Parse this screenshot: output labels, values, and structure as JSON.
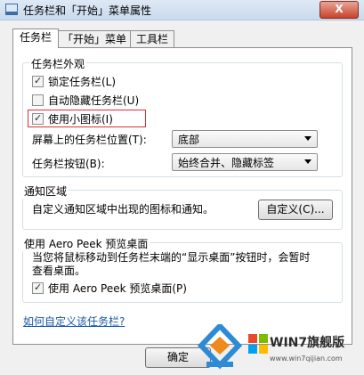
{
  "window": {
    "title": "任务栏和「开始」菜单属性",
    "close_label": "X"
  },
  "tabs": [
    {
      "label": "任务栏"
    },
    {
      "label": "「开始」菜单"
    },
    {
      "label": "工具栏"
    }
  ],
  "appearance": {
    "title": "任务栏外观",
    "lock_taskbar": {
      "label": "锁定任务栏(L)",
      "checked": true
    },
    "auto_hide": {
      "label": "自动隐藏任务栏(U)",
      "checked": false
    },
    "small_icons": {
      "label": "使用小图标(I)",
      "checked": true
    },
    "location": {
      "label": "屏幕上的任务栏位置(T):",
      "value": "底部"
    },
    "buttons": {
      "label": "任务栏按钮(B):",
      "value": "始终合并、隐藏标签"
    }
  },
  "notification": {
    "title": "通知区域",
    "description": "自定义通知区域中出现的图标和通知。",
    "customize_label": "自定义(C)..."
  },
  "aero_peek": {
    "title": "使用 Aero Peek 预览桌面",
    "description_line1": "当您将鼠标移动到任务栏末端的“显示桌面”按钮时，会暂时",
    "description_line2": "查看桌面。",
    "checkbox_label": "使用 Aero Peek 预览桌面(P)",
    "checked": true
  },
  "help_link": "如何自定义该任务栏?",
  "footer": {
    "ok_label": "确定"
  },
  "watermark": {
    "brand": "WIN7旗舰版",
    "url": "www.win7qijian.com"
  },
  "colors": {
    "highlight_box": "#d8322f",
    "link": "#1a5aa8"
  }
}
